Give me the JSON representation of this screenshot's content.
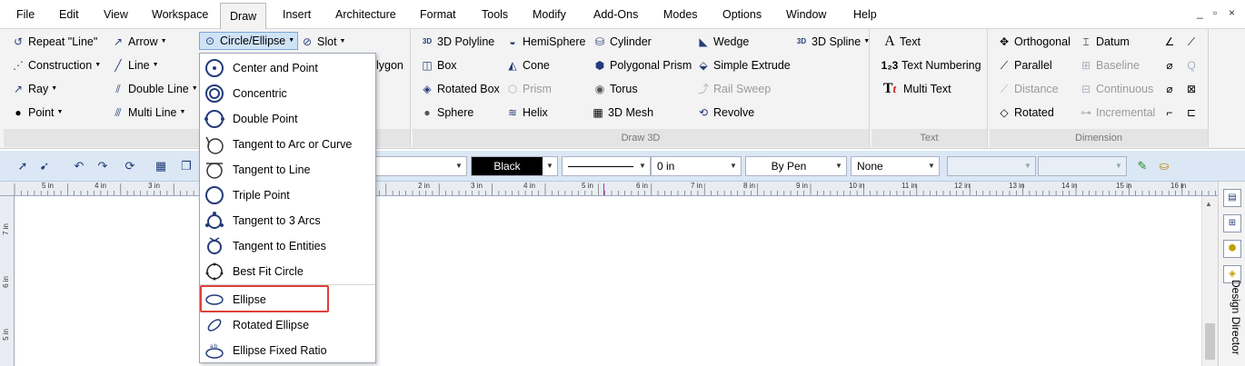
{
  "menubar": {
    "items": [
      "File",
      "Edit",
      "View",
      "Workspace",
      "Draw",
      "Insert",
      "Architecture",
      "Format",
      "Tools",
      "Modify",
      "Add-Ons",
      "Modes",
      "Options",
      "Window",
      "Help"
    ],
    "active": "Draw",
    "window_controls": [
      "_",
      "▫",
      "×"
    ]
  },
  "ribbon": {
    "draw_group": {
      "caption": "Dr",
      "col1": [
        {
          "label": "Repeat \"Line\"",
          "icon": "repeat-arrow-icon"
        },
        {
          "label": "Construction",
          "icon": "construction-line-icon"
        },
        {
          "label": "Ray",
          "icon": "ray-icon"
        },
        {
          "label": "Point",
          "icon": "point-icon"
        }
      ],
      "col2": [
        {
          "label": "Arrow",
          "icon": "arrow-icon"
        },
        {
          "label": "Line",
          "icon": "line-icon"
        },
        {
          "label": "Double Line",
          "icon": "double-line-icon"
        },
        {
          "label": "Multi Line",
          "icon": "multi-line-icon"
        }
      ],
      "circle_ellipse": "Circle/Ellipse",
      "slot": "Slot",
      "polygon_partial": "lygon"
    },
    "draw3d_group": {
      "caption": "Draw 3D",
      "col1": [
        "3D Polyline",
        "Box",
        "Rotated Box",
        "Sphere"
      ],
      "col2": [
        "HemiSphere",
        "Cone",
        "Prism",
        "Helix"
      ],
      "col3": [
        "Cylinder",
        "Polygonal Prism",
        "Torus",
        "3D Mesh"
      ],
      "col4": [
        "Wedge",
        "Simple Extrude",
        "Rail Sweep",
        "Revolve"
      ],
      "spline": "3D Spline"
    },
    "text_group": {
      "caption": "Text",
      "items": [
        "Text",
        "Text Numbering",
        "Multi Text"
      ]
    },
    "dimension_group": {
      "caption": "Dimension",
      "col1": [
        "Orthogonal",
        "Parallel",
        "Distance",
        "Rotated"
      ],
      "col2": [
        "Datum",
        "Baseline",
        "Continuous",
        "Incremental"
      ]
    }
  },
  "toolbar": {
    "color": "Black",
    "thickness": "0 in",
    "pen": "By Pen",
    "fill": "None"
  },
  "ruler": {
    "labels": [
      "5 in",
      "4 in",
      "3 in",
      "2 in",
      "3 in",
      "4 in",
      "5 in",
      "6 in",
      "7 in",
      "8 in",
      "9 in",
      "10 in",
      "11 in",
      "12 in",
      "13 in",
      "14 in",
      "15 in",
      "16 in"
    ],
    "vlabels": [
      "7 in",
      "6 in",
      "5 in"
    ]
  },
  "side_panel": {
    "title": "Design Director"
  },
  "dropdown": {
    "items": [
      {
        "label": "Center and Point",
        "icon": "center-point-circle-icon"
      },
      {
        "label": "Concentric",
        "icon": "concentric-circle-icon"
      },
      {
        "label": "Double Point",
        "icon": "double-point-circle-icon"
      },
      {
        "label": "Tangent to Arc or Curve",
        "icon": "tangent-arc-circle-icon"
      },
      {
        "label": "Tangent to Line",
        "icon": "tangent-line-circle-icon"
      },
      {
        "label": "Triple Point",
        "icon": "triple-point-circle-icon"
      },
      {
        "label": "Tangent to 3 Arcs",
        "icon": "tangent-3-arcs-circle-icon"
      },
      {
        "label": "Tangent to Entities",
        "icon": "tangent-entities-circle-icon"
      },
      {
        "label": "Best Fit Circle",
        "icon": "best-fit-circle-icon"
      },
      {
        "label": "Ellipse",
        "icon": "ellipse-icon"
      },
      {
        "label": "Rotated Ellipse",
        "icon": "rotated-ellipse-icon"
      },
      {
        "label": "Ellipse Fixed Ratio",
        "icon": "ellipse-fixed-ratio-icon"
      }
    ],
    "highlighted": "Ellipse",
    "highlight_color": "#e0403a"
  },
  "colors": {
    "accent": "#243c7a",
    "ribbon_bg": "#f3f3f3",
    "toolbar_bg": "#dbe7f4"
  }
}
